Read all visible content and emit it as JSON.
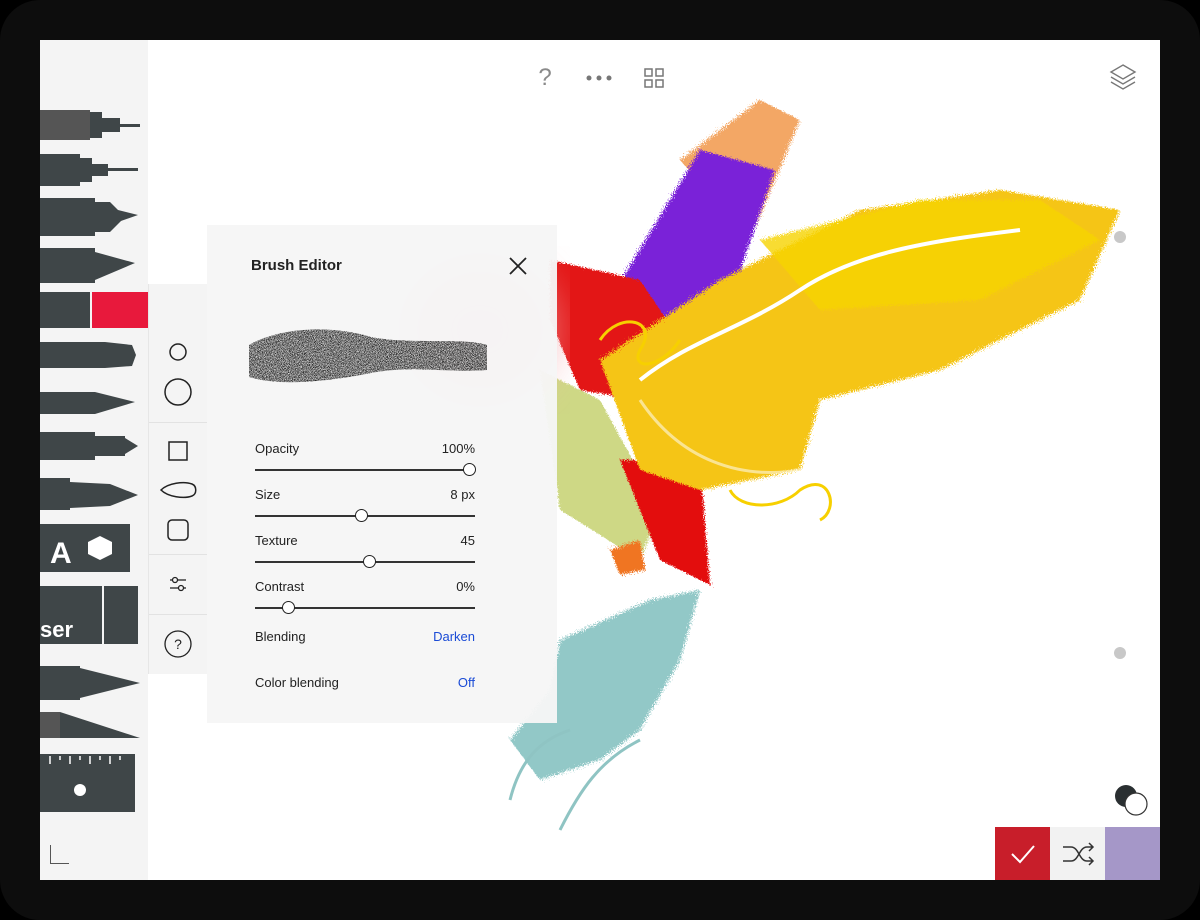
{
  "brush_editor": {
    "title": "Brush Editor",
    "controls": [
      {
        "label": "Opacity",
        "value": "100%",
        "fraction": 1.0
      },
      {
        "label": "Size",
        "value": "8 px",
        "fraction": 0.48
      },
      {
        "label": "Texture",
        "value": "45",
        "fraction": 0.52
      },
      {
        "label": "Contrast",
        "value": "0%",
        "fraction": 0.13
      }
    ],
    "blending": {
      "label": "Blending",
      "value": "Darken"
    },
    "color_blending": {
      "label": "Color blending",
      "value": "Off"
    }
  },
  "toolbar": {
    "text_tool_letter": "A",
    "eraser_label": "ser"
  },
  "top_bar": {
    "help_glyph": "?",
    "icons": [
      "question-icon",
      "more-icon",
      "grid-icon",
      "layers-icon"
    ]
  },
  "colors": {
    "accent_red": "#e0192d",
    "swatch": "#a597c8",
    "confirm": "#c81e2a",
    "tool_dark": "#3f4648",
    "link": "#1a4bd6"
  }
}
